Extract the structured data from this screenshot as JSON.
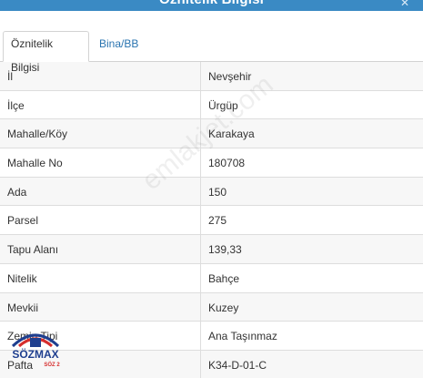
{
  "window": {
    "title": "Öznitelik Bilgisi"
  },
  "tabs": [
    {
      "label": "Öznitelik Bilgisi",
      "active": true
    },
    {
      "label": "Bina/BB Listesi",
      "active": false
    }
  ],
  "attributes": [
    {
      "key": "İl",
      "value": "Nevşehir"
    },
    {
      "key": "İlçe",
      "value": "Ürgüp"
    },
    {
      "key": "Mahalle/Köy",
      "value": "Karakaya"
    },
    {
      "key": "Mahalle No",
      "value": "180708"
    },
    {
      "key": "Ada",
      "value": "150"
    },
    {
      "key": "Parsel",
      "value": "275"
    },
    {
      "key": "Tapu Alanı",
      "value": "139,33"
    },
    {
      "key": "Nitelik",
      "value": "Bahçe"
    },
    {
      "key": "Mevkii",
      "value": "Kuzey"
    },
    {
      "key": "Zemin Tipi",
      "value": "Ana Taşınmaz"
    },
    {
      "key": "Pafta",
      "value": "K34-D-01-C"
    }
  ],
  "watermark": "emlakjet.com",
  "logo": {
    "text": "SÖZMAX",
    "subtext": "SÖZ 2"
  },
  "colors": {
    "titlebar": "#3a8ac4",
    "tab_link": "#2a74b0",
    "row_alt": "#f7f7f7",
    "border": "#dddddd"
  }
}
